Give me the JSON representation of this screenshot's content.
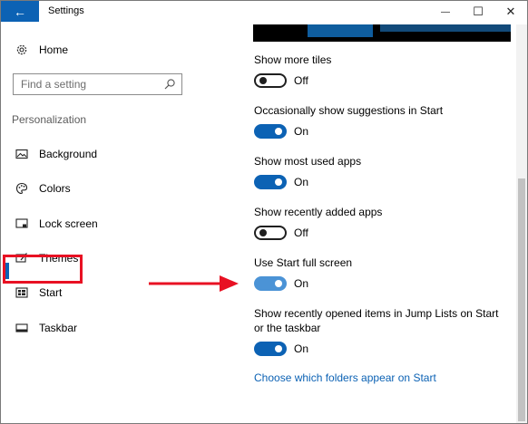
{
  "window": {
    "title": "Settings",
    "back_icon": "←",
    "minimize_icon": "—",
    "maximize_icon": "☐",
    "close_icon": "✕"
  },
  "sidebar": {
    "home_label": "Home",
    "search_placeholder": "Find a setting",
    "section_heading": "Personalization",
    "items": [
      {
        "label": "Background",
        "icon": "picture-icon"
      },
      {
        "label": "Colors",
        "icon": "palette-icon"
      },
      {
        "label": "Lock screen",
        "icon": "lock-screen-icon"
      },
      {
        "label": "Themes",
        "icon": "themes-icon"
      },
      {
        "label": "Start",
        "icon": "start-icon",
        "selected": true
      },
      {
        "label": "Taskbar",
        "icon": "taskbar-icon"
      }
    ]
  },
  "settings": [
    {
      "label": "Show more tiles",
      "state": "Off",
      "on": false
    },
    {
      "label": "Occasionally show suggestions in Start",
      "state": "On",
      "on": true
    },
    {
      "label": "Show most used apps",
      "state": "On",
      "on": true
    },
    {
      "label": "Show recently added apps",
      "state": "Off",
      "on": false
    },
    {
      "label": "Use Start full screen",
      "state": "On",
      "on": true
    },
    {
      "label_line1": "Show recently opened items in Jump Lists on Start",
      "label_line2": "or the taskbar",
      "state": "On",
      "on": true
    }
  ],
  "link": "Choose which folders appear on Start",
  "colors": {
    "accent": "#0c62b4",
    "highlight": "#e81123"
  }
}
